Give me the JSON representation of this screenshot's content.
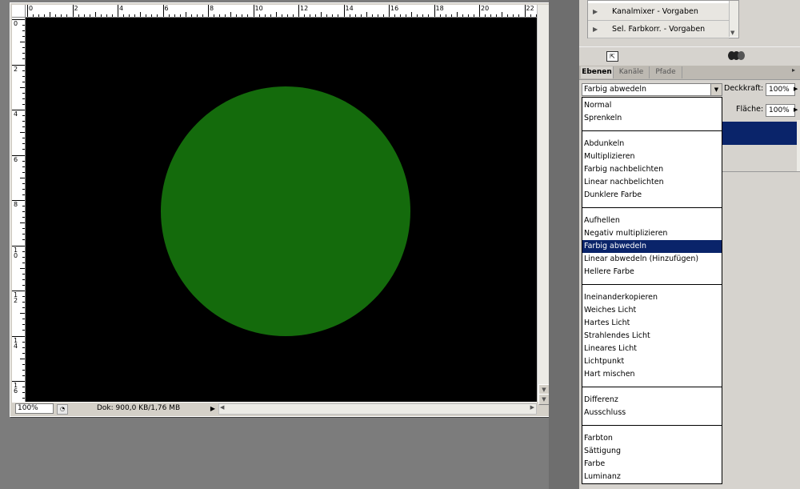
{
  "colors": {
    "canvas_bg": "#000000",
    "circle_fill": "#146b0c",
    "selection": "#0a246a",
    "workspace": "#7c7c7c"
  },
  "ruler": {
    "h_labels": [
      "0",
      "2",
      "4",
      "6",
      "8",
      "10",
      "12",
      "14",
      "16",
      "18",
      "20",
      "22"
    ],
    "v_labels": [
      "0",
      "2",
      "4",
      "6",
      "8",
      "10",
      "12",
      "14",
      "16"
    ]
  },
  "status": {
    "zoom": "100%",
    "doc_size": "Dok: 900,0 KB/1,76 MB"
  },
  "presets": [
    {
      "label": "Kanalmixer - Vorgaben",
      "icon": "triangle-right-icon"
    },
    {
      "label": "Sel. Farbkorr. - Vorgaben",
      "icon": "triangle-right-icon"
    }
  ],
  "layers_panel": {
    "tabs": [
      "Ebenen",
      "Kanäle",
      "Pfade"
    ],
    "active_tab": "Ebenen",
    "blend_mode": "Farbig abwedeln",
    "opacity_label": "Deckkraft:",
    "opacity_value": "100%",
    "fill_label": "Fläche:",
    "fill_value": "100%"
  },
  "blend_modes": [
    [
      "Normal",
      "Sprenkeln"
    ],
    [
      "Abdunkeln",
      "Multiplizieren",
      "Farbig nachbelichten",
      "Linear nachbelichten",
      "Dunklere Farbe"
    ],
    [
      "Aufhellen",
      "Negativ multiplizieren",
      "Farbig abwedeln",
      "Linear abwedeln (Hinzufügen)",
      "Hellere Farbe"
    ],
    [
      "Ineinanderkopieren",
      "Weiches Licht",
      "Hartes Licht",
      "Strahlendes Licht",
      "Lineares Licht",
      "Lichtpunkt",
      "Hart mischen"
    ],
    [
      "Differenz",
      "Ausschluss"
    ],
    [
      "Farbton",
      "Sättigung",
      "Farbe",
      "Luminanz"
    ]
  ],
  "selected_blend_mode": "Farbig abwedeln"
}
